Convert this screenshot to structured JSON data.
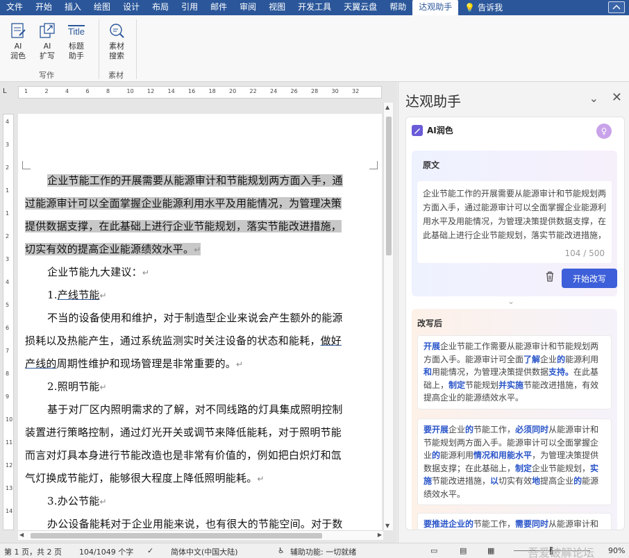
{
  "menu": {
    "tabs": [
      "文件",
      "开始",
      "插入",
      "绘图",
      "设计",
      "布局",
      "引用",
      "邮件",
      "审阅",
      "视图",
      "开发工具",
      "天翼云盘",
      "帮助",
      "达观助手"
    ],
    "active_tab": "达观助手",
    "tell_me": "告诉我"
  },
  "ribbon": {
    "ai_polish": [
      "AI",
      "润色"
    ],
    "ai_expand": [
      "AI",
      "扩写"
    ],
    "title_helper_icon": "Title",
    "title_helper": [
      "标题",
      "助手"
    ],
    "material_search": [
      "素材",
      "搜索"
    ],
    "group_writing": "写作",
    "group_material": "素材"
  },
  "ruler": {
    "corner": "L",
    "h_marks": [
      "1",
      "2",
      "4",
      "6",
      "8",
      "10",
      "12",
      "14",
      "16",
      "18",
      "20",
      "22",
      "24",
      "26",
      "28",
      "30",
      "32"
    ],
    "v_marks": [
      "4",
      "3",
      "2",
      "1",
      "1",
      "2",
      "3",
      "4",
      "5",
      "6",
      "7",
      "8",
      "9",
      "10",
      "11",
      "12",
      "13",
      "14",
      "15"
    ]
  },
  "document": {
    "p1_lines": [
      "企业节能工作的开展需要从能源审计和节能规划两方面入手，通",
      "过能源审计可以全面掌握企业能源利用水平及用能情况，为管理决策",
      "提供数据支撑，在此基础上进行企业节能规划，落实节能改进措施，",
      "切实有效的提高企业能源绩效水平。"
    ],
    "p2": "企业节能九大建议：",
    "h1_num": "1.",
    "h1_text": "产线节能",
    "p3_lines": [
      "不当的设备使用和维护，对于制造型企业来说会产生额外的能源",
      "损耗以及热能产生，通过系统监测实时关注设备的状态和能耗，",
      "产线的周期性维护和现场管理是非常重要的。"
    ],
    "p3_link_a": "做好",
    "p3_link_b": "产线的",
    "h2": "2.照明节能",
    "p4_lines": [
      "基于对厂区内照明需求的了解，对不同线路的灯具集成照明控制",
      "装置进行策略控制，通过灯光开关或调节来降低能耗，对于照明节能",
      "而言对灯具本身进行节能改造也是非常有价值的，例如把白炽灯和氙",
      "气灯换成节能灯，能够很大程度上降低照明能耗。"
    ],
    "h3": "3.办公节能",
    "p5": "办公设备能耗对于企业用能来说，也有很大的节能空间。对于数",
    "para_mark": "↵"
  },
  "pane": {
    "title": "达观助手",
    "tool_name": "AI润色",
    "avatar_glyph": "♀",
    "original_label": "原文",
    "original_text": "企业节能工作的开展需要从能源审计和节能规划两方面入手，通过能源审计可以全面掌握企业能源利用水平及用能情况，为管理决策提供数据支撑，在此基础上进行企业节能规划，落实节能改进措施，切实有效的提高企业能源绩效水平。",
    "char_count": "104 / 500",
    "start_button": "开始改写",
    "rewrite_label": "改写后",
    "rewrite_1": [
      {
        "t": "开展",
        "b": true
      },
      {
        "t": "企业节能工作需要从能源审计和节能规划两方面入手。"
      },
      {
        "t": "能源审计可全面",
        "b": false
      },
      {
        "t": "了解",
        "b": true
      },
      {
        "t": "企业"
      },
      {
        "t": "的",
        "b": true
      },
      {
        "t": "能源利用"
      },
      {
        "t": "和",
        "b": true
      },
      {
        "t": "用能情况，为管理决策提供数据"
      },
      {
        "t": "支持。",
        "b": true
      },
      {
        "t": "在此基础上，"
      },
      {
        "t": "制定",
        "b": true
      },
      {
        "t": "节能规划"
      },
      {
        "t": "并实施",
        "b": true
      },
      {
        "t": "节能改进措施，有效提高企业的能源绩效水平。"
      }
    ],
    "rewrite_2": [
      {
        "t": "要开展",
        "b": true
      },
      {
        "t": "企业"
      },
      {
        "t": "的",
        "b": true
      },
      {
        "t": "节能工作，"
      },
      {
        "t": "必须同时",
        "b": true
      },
      {
        "t": "从能源审计和节能规划两方面入手。能源审计可以全面掌握企业"
      },
      {
        "t": "的",
        "b": true
      },
      {
        "t": "能源利用"
      },
      {
        "t": "情况和用能水平",
        "b": true
      },
      {
        "t": "，为管理决策提供数据支撑；在此基础上，"
      },
      {
        "t": "制定",
        "b": true
      },
      {
        "t": "企业节能规划，"
      },
      {
        "t": "实施",
        "b": true
      },
      {
        "t": "节能改进措施，"
      },
      {
        "t": "以",
        "b": true
      },
      {
        "t": "切实有效"
      },
      {
        "t": "地",
        "b": true
      },
      {
        "t": "提高企业"
      },
      {
        "t": "的",
        "b": true
      },
      {
        "t": "能源绩效水平。"
      }
    ],
    "rewrite_3": [
      {
        "t": "要推进企业的",
        "b": true
      },
      {
        "t": "节能工作，"
      },
      {
        "t": "需要同时",
        "b": true
      },
      {
        "t": "从能源审计和节"
      }
    ]
  },
  "status": {
    "page": "第 1 页，共 2 页",
    "words": "104/1049 个字",
    "language": "简体中文(中国大陆)",
    "accessibility": "辅助功能: 一切就绪",
    "zoom": "90%",
    "watermark": "吾爱破解论坛"
  },
  "colors": {
    "menubar": "#2b579a",
    "accent": "#3d5fd9",
    "highlight_text": "#2a55c9",
    "selection": "#c8c8c8"
  }
}
